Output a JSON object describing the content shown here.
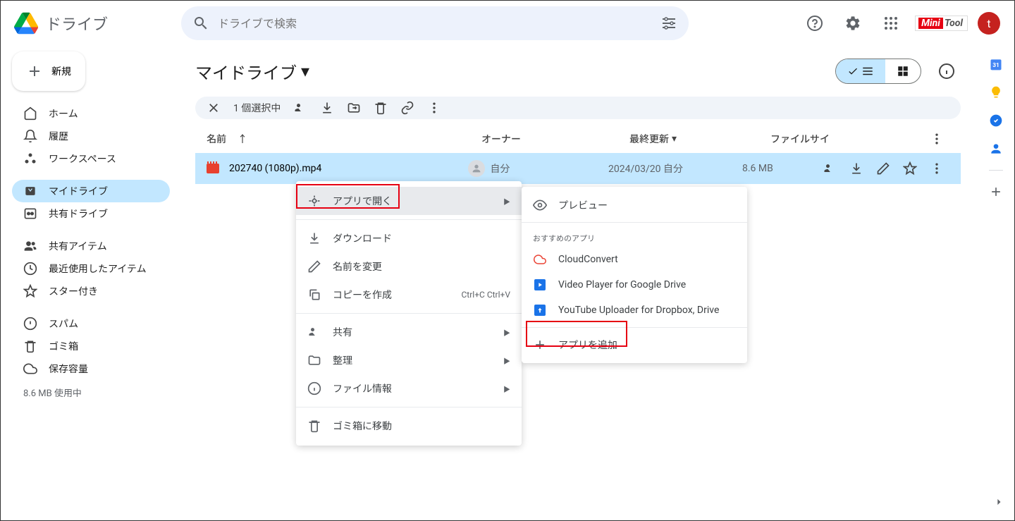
{
  "header": {
    "app_name": "ドライブ",
    "search_placeholder": "ドライブで検索",
    "avatar_letter": "t",
    "badge_left": "Mini",
    "badge_right": "Tool"
  },
  "sidebar": {
    "new_label": "新規",
    "items": [
      {
        "icon": "home",
        "label": "ホーム"
      },
      {
        "icon": "bell",
        "label": "履歴"
      },
      {
        "icon": "workspaces",
        "label": "ワークスペース"
      }
    ],
    "drives": [
      {
        "icon": "mydrive",
        "label": "マイドライブ",
        "active": true
      },
      {
        "icon": "shareddrive",
        "label": "共有ドライブ"
      }
    ],
    "shared": [
      {
        "icon": "people",
        "label": "共有アイテム"
      },
      {
        "icon": "clock",
        "label": "最近使用したアイテム"
      },
      {
        "icon": "star",
        "label": "スター付き"
      }
    ],
    "bottom": [
      {
        "icon": "spam",
        "label": "スパム"
      },
      {
        "icon": "trash",
        "label": "ゴミ箱"
      },
      {
        "icon": "cloud",
        "label": "保存容量"
      }
    ],
    "storage_used": "8.6 MB 使用中"
  },
  "main": {
    "title": "マイドライブ",
    "selection_text": "1 個選択中",
    "columns": {
      "name": "名前",
      "owner": "オーナー",
      "modified": "最終更新",
      "size": "ファイルサイ"
    },
    "file": {
      "name": "202740 (1080p).mp4",
      "owner": "自分",
      "date": "2024/03/20 自分",
      "size": "8.6 MB"
    }
  },
  "context_menu": {
    "open_with": "アプリで開く",
    "download": "ダウンロード",
    "rename": "名前を変更",
    "copy": "コピーを作成",
    "copy_shortcut": "Ctrl+C Ctrl+V",
    "share": "共有",
    "organize": "整理",
    "file_info": "ファイル情報",
    "move_to_trash": "ゴミ箱に移動"
  },
  "submenu": {
    "preview": "プレビュー",
    "suggested_header": "おすすめのアプリ",
    "apps": [
      {
        "label": "CloudConvert",
        "color": "#ea4335"
      },
      {
        "label": "Video Player for Google Drive",
        "color": "#1a73e8"
      },
      {
        "label": "YouTube Uploader for Dropbox, Drive",
        "color": "#1a73e8"
      }
    ],
    "add_apps": "アプリを追加"
  }
}
